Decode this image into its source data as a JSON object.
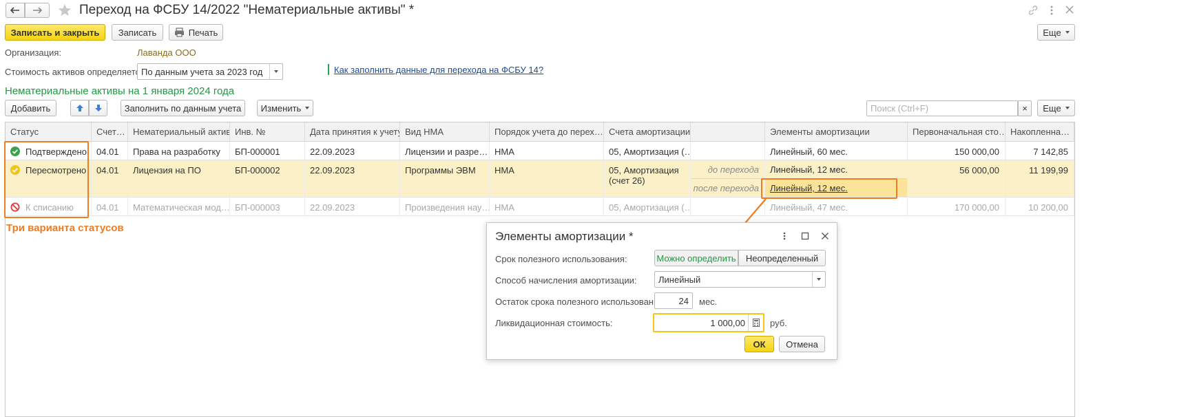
{
  "window": {
    "title": "Переход на ФСБУ 14/2022 \"Нематериальные активы\" *"
  },
  "toolbar": {
    "save_close": "Записать и закрыть",
    "save": "Записать",
    "print": "Печать",
    "more": "Еще"
  },
  "form": {
    "org_label": "Организация:",
    "org_value": "Лаванда ООО",
    "cost_label": "Стоимость активов определяется:",
    "cost_value": "По данным учета за 2023 год",
    "help_link": "Как заполнить данные для перехода на ФСБУ 14?"
  },
  "section": {
    "title": "Нематериальные активы на 1 января 2024 года",
    "add": "Добавить",
    "fill": "Заполнить по данным учета",
    "change": "Изменить",
    "search_placeholder": "Поиск (Ctrl+F)",
    "search_clear": "×",
    "more": "Еще"
  },
  "table": {
    "headers": [
      "Статус",
      "Счет…",
      "Нематериальный актив",
      "Инв. №",
      "Дата принятия к учету",
      "Вид НМА",
      "Порядок учета до перех…",
      "Счета амортизации",
      "",
      "Элементы амортизации",
      "Первоначальная сто…",
      "Накопленна…"
    ],
    "rows": [
      {
        "status": "Подтверждено",
        "account": "04.01",
        "asset": "Права на разработку",
        "inv": "БП-000001",
        "date": "22.09.2023",
        "kind": "Лицензии и разре…",
        "order": "НМА",
        "amort_acc": "05, Амортизация (…",
        "note": "",
        "elements": "Линейный, 60 мес.",
        "initial": "150 000,00",
        "accum": "7 142,85"
      },
      {
        "status": "Пересмотрено",
        "account": "04.01",
        "asset": "Лицензия на ПО",
        "inv": "БП-000002",
        "date": "22.09.2023",
        "kind": "Программы ЭВМ",
        "order": "НМА",
        "amort_acc": "05, Амортизация",
        "amort_acc2": "(счет 26)",
        "note": "до перехода",
        "note2": "после перехода",
        "elements": "Линейный, 12 мес.",
        "elements2": "Линейный, 12 мес.",
        "initial": "56 000,00",
        "accum": "11 199,99"
      },
      {
        "status": "К списанию",
        "account": "04.01",
        "asset": "Математическая мод…",
        "inv": "БП-000003",
        "date": "22.09.2023",
        "kind": "Произведения нау…",
        "order": "НМА",
        "amort_acc": "05, Амортизация (…",
        "note": "",
        "elements": "Линейный, 47 мес.",
        "initial": "170 000,00",
        "accum": "10 200,00"
      }
    ]
  },
  "annotation": {
    "text": "Три варианта статусов"
  },
  "dialog": {
    "title": "Элементы амортизации *",
    "life_label": "Срок полезного использования:",
    "life_opt1": "Можно определить",
    "life_opt2": "Неопределенный",
    "method_label": "Способ начисления амортизации:",
    "method_value": "Линейный",
    "remain_label": "Остаток срока полезного использования:",
    "remain_value": "24",
    "remain_unit": "мес.",
    "salvage_label": "Ликвидационная стоимость:",
    "salvage_value": "1 000,00",
    "salvage_unit": "руб.",
    "ok": "ОК",
    "cancel": "Отмена"
  },
  "colors": {
    "accent_yellow": "#f5d410",
    "green_title": "#1f9a41",
    "annotation_orange": "#f07c22",
    "org_brown": "#8a6a1f"
  }
}
